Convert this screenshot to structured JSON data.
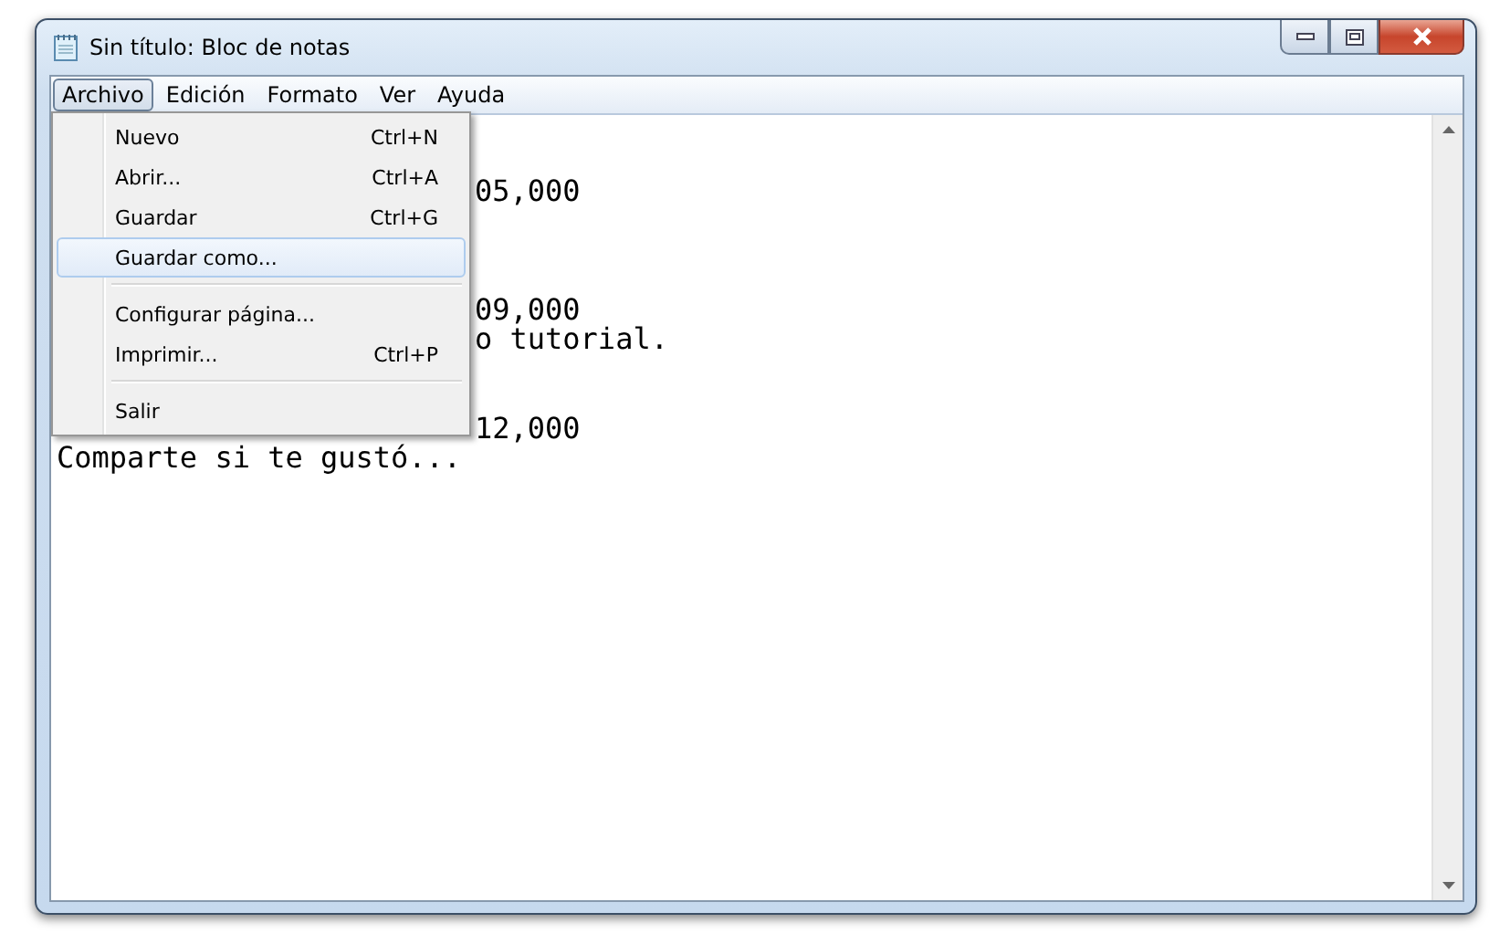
{
  "window": {
    "title": "Sin título: Bloc de notas"
  },
  "menu_bar": [
    {
      "label": "Archivo",
      "selected": true
    },
    {
      "label": "Edición",
      "selected": false
    },
    {
      "label": "Formato",
      "selected": false
    },
    {
      "label": "Ver",
      "selected": false
    },
    {
      "label": "Ayuda",
      "selected": false
    }
  ],
  "dropdown": [
    {
      "kind": "item",
      "label": "Nuevo",
      "shortcut": "Ctrl+N",
      "selected": false
    },
    {
      "kind": "item",
      "label": "Abrir...",
      "shortcut": "Ctrl+A",
      "selected": false
    },
    {
      "kind": "item",
      "label": "Guardar",
      "shortcut": "Ctrl+G",
      "selected": false
    },
    {
      "kind": "item",
      "label": "Guardar como...",
      "selected": true
    },
    {
      "kind": "separator"
    },
    {
      "kind": "item",
      "label": "Configurar página...",
      "selected": false
    },
    {
      "kind": "item",
      "label": "Imprimir...",
      "shortcut": "Ctrl+P",
      "selected": false
    },
    {
      "kind": "separator"
    },
    {
      "kind": "item",
      "label": "Salir",
      "selected": false
    }
  ],
  "editor": {
    "lines": [
      {
        "covered": true,
        "text": "05,000"
      },
      {
        "covered": true,
        "text": "09,000"
      },
      {
        "covered": true,
        "text": "o tutorial."
      },
      {
        "covered": true,
        "text": "12,000"
      },
      {
        "covered": false,
        "text": "Comparte si te gustó..."
      }
    ]
  }
}
